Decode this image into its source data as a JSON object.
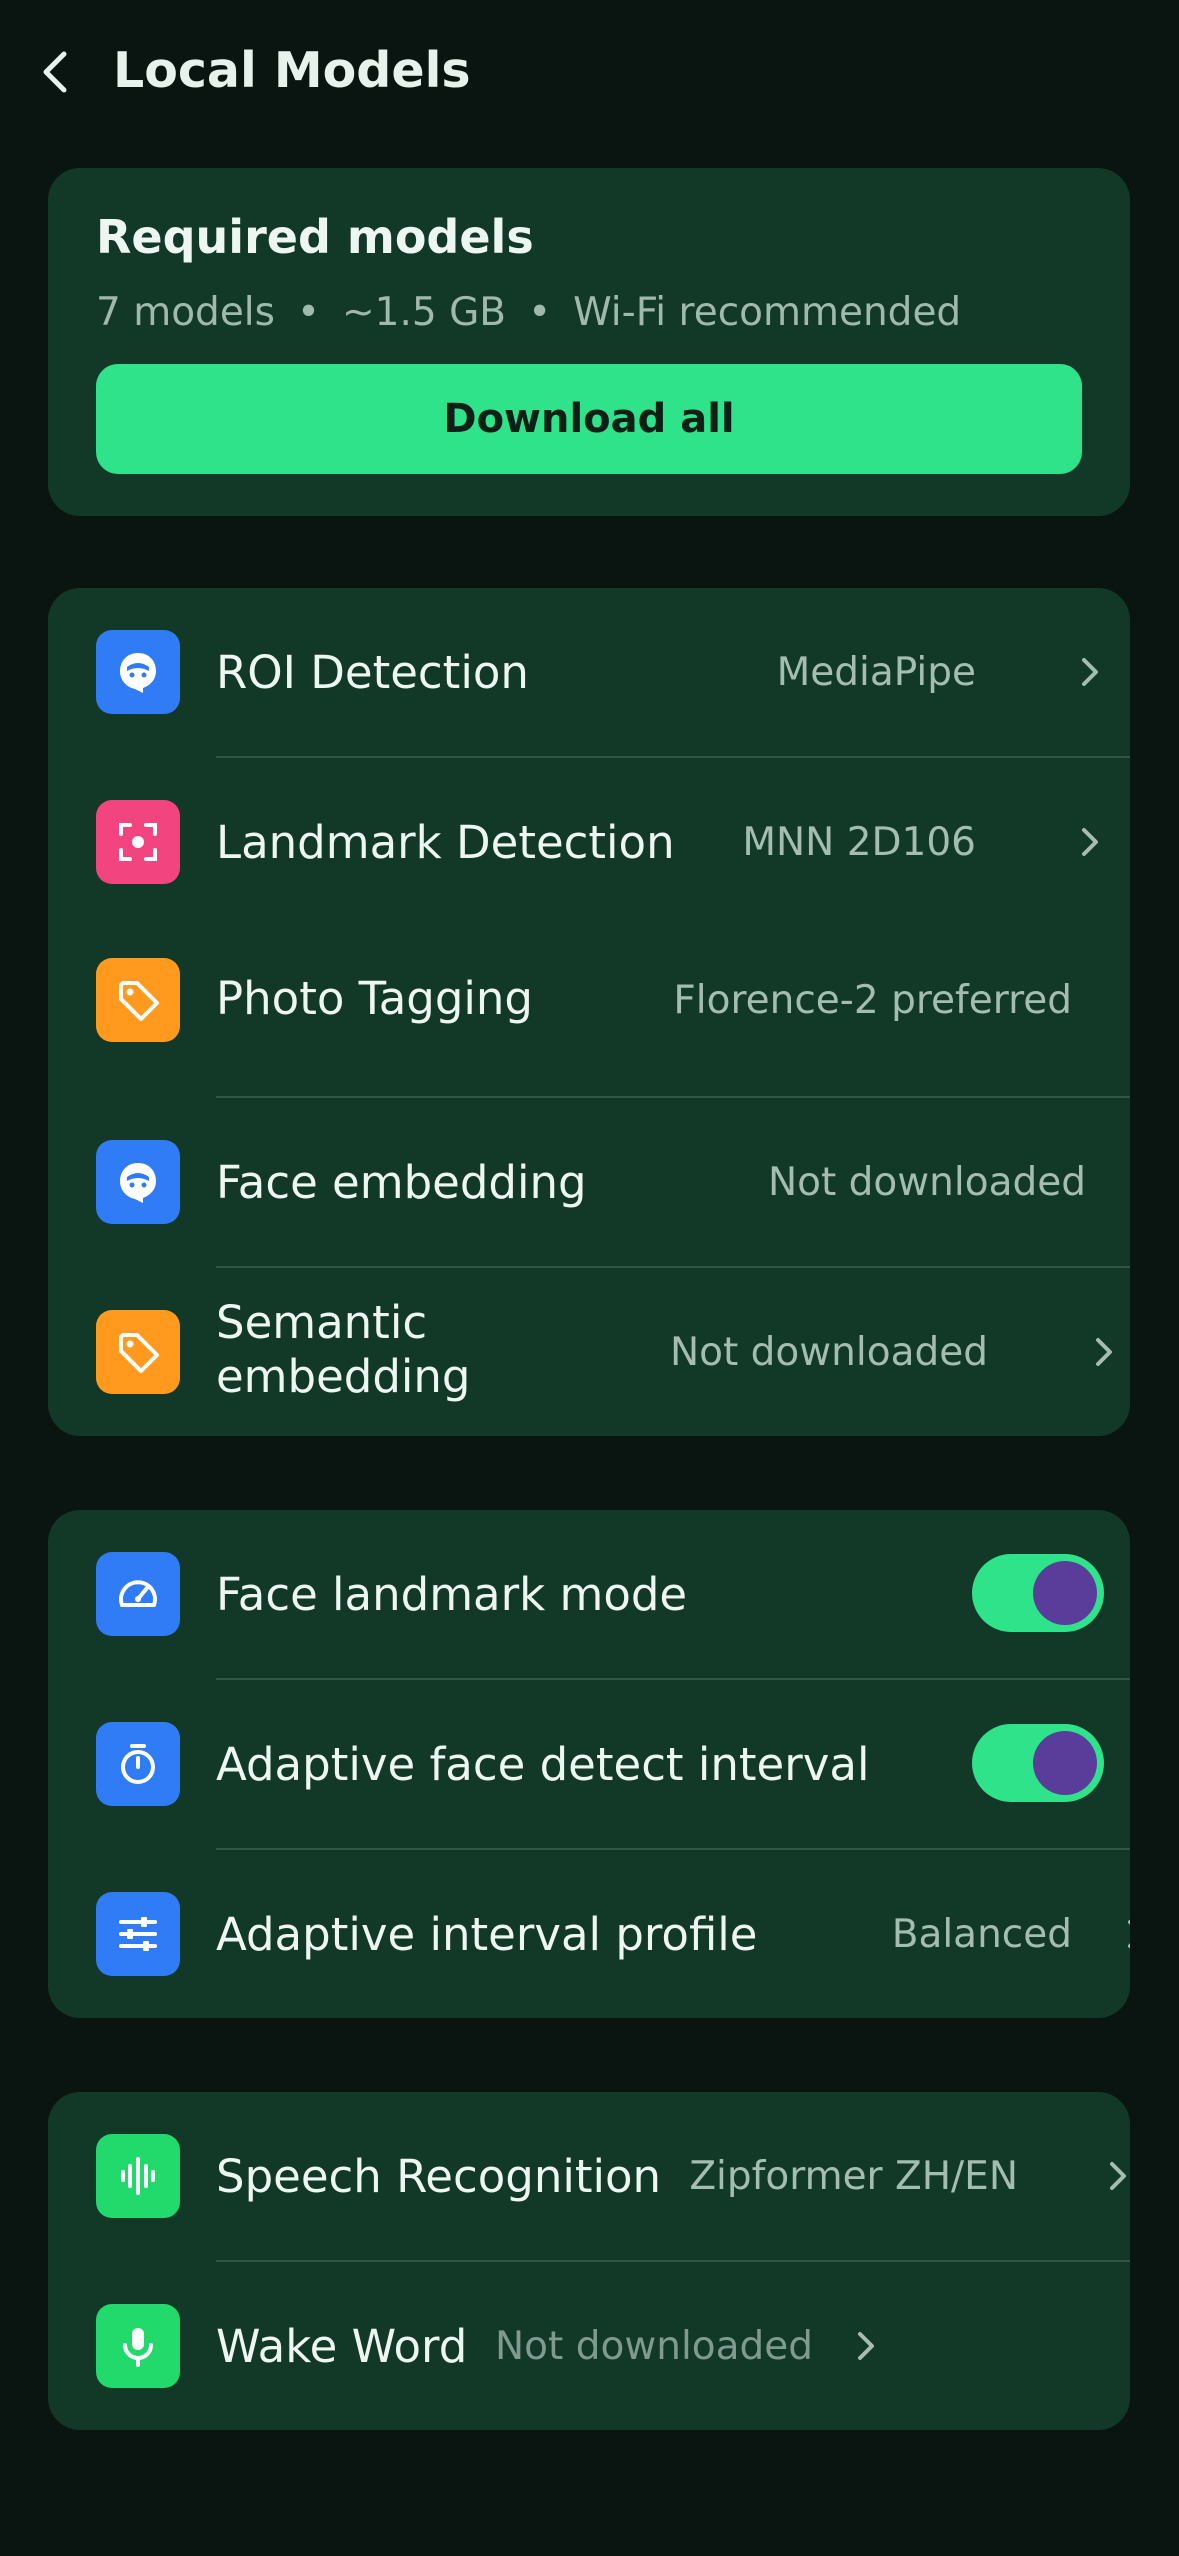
{
  "header": {
    "title": "Local Models"
  },
  "required": {
    "title": "Required models",
    "meta": [
      "7 models",
      "~1.5 GB",
      "Wi-Fi recommended"
    ],
    "separator": "•",
    "download_label": "Download all",
    "button_color": "#2fe38a"
  },
  "models": [
    {
      "label": "ROI Detection",
      "value": "MediaPipe",
      "icon": "face-icon"
    },
    {
      "label": "Landmark Detection",
      "value": "MNN 2D106",
      "icon": "scan-icon"
    },
    {
      "label": "Photo Tagging",
      "value": "Florence-2 preferred",
      "icon": "tag-icon"
    },
    {
      "label": "Face embedding",
      "value": "Not downloaded",
      "icon": "face-icon"
    },
    {
      "label_line1": "Semantic",
      "label_line2": "embedding",
      "value": "Not downloaded",
      "icon": "tag-icon"
    }
  ],
  "face_settings": [
    {
      "label": "Face landmark mode",
      "enabled": true,
      "icon": "gauge-icon"
    },
    {
      "label": "Adaptive face detect interval",
      "enabled": true,
      "icon": "timer-icon"
    },
    {
      "label": "Adaptive interval profile",
      "value": "Balanced",
      "icon": "sliders-icon"
    }
  ],
  "speech": [
    {
      "label": "Speech Recognition",
      "value": "Zipformer ZH/EN",
      "icon": "waveform-icon"
    },
    {
      "label": "Wake Word",
      "value": "Not downloaded",
      "icon": "microphone-icon"
    }
  ],
  "colors": {
    "background": "#0a1512",
    "card": "#123828",
    "accent": "#2fe38a",
    "toggle_knob": "#5a3d9a"
  }
}
